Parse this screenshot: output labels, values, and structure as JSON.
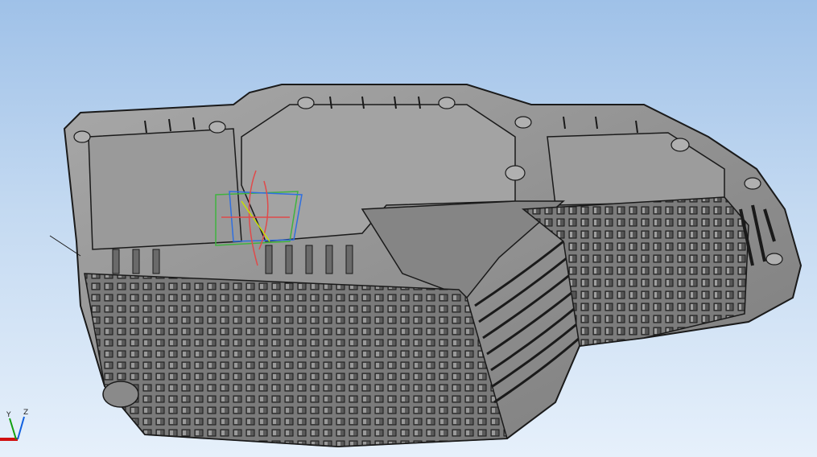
{
  "viewport": {
    "background_top": "#9fc1e8",
    "background_bottom": "#e6f0fb"
  },
  "model": {
    "name": "oil-pan-part",
    "body_color": "#8e8e8e",
    "edge_color": "#1a1a1a",
    "fin_color": "#6e6e6e"
  },
  "sketch_plane": {
    "colors": [
      "#3fb33f",
      "#2f6fe0",
      "#e04a4a",
      "#c8e000"
    ]
  },
  "triad": {
    "labels": {
      "y": "Y",
      "z": "Z"
    },
    "colors": {
      "x": "#d01010",
      "y": "#10a010",
      "z": "#1060e0"
    }
  }
}
